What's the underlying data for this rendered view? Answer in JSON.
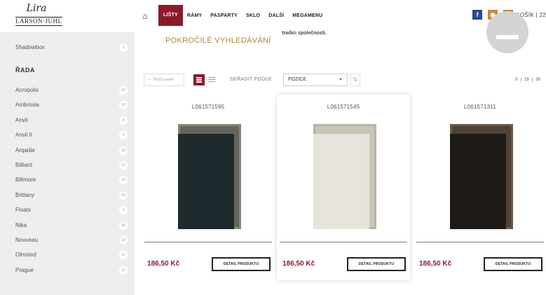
{
  "header": {
    "logo_script": "Lira",
    "logo_text": "LARSON·JUHL",
    "nav_home_icon": "home-icon",
    "nav": [
      "LIŠTY",
      "RÁMY",
      "PASPARTY",
      "SKLO",
      "DALŠÍ",
      "MEGAMENU"
    ],
    "active_nav": "LIŠTY",
    "cart_label": "KOŠÍK | 22"
  },
  "sidebar": {
    "top_item": {
      "label": "Shadowbox",
      "count": "1"
    },
    "section_title": "ŘADA",
    "items": [
      {
        "label": "Acropolis",
        "count": "10"
      },
      {
        "label": "Ambrosia",
        "count": "16"
      },
      {
        "label": "Anvil",
        "count": "4"
      },
      {
        "label": "Anvil II",
        "count": "5"
      },
      {
        "label": "Arqadia",
        "count": "18"
      },
      {
        "label": "Billiard",
        "count": "12"
      },
      {
        "label": "Biltmore",
        "count": "14"
      },
      {
        "label": "Brittany",
        "count": "16"
      },
      {
        "label": "Floats",
        "count": "4"
      },
      {
        "label": "Nika",
        "count": "24"
      },
      {
        "label": "Nouveau",
        "count": "18"
      },
      {
        "label": "Olmsted",
        "count": "11"
      },
      {
        "label": "Prague",
        "count": "12"
      }
    ]
  },
  "main": {
    "advanced_search": "POKROČILÉ VYHLEDÁVÁNÍ",
    "intro_snippet": "tradici společnosti.",
    "hide_panel": "— Skrýt panel",
    "sort_label": "SEŘADIT PODLE",
    "sort_value": "POZICE",
    "per_page": [
      "9",
      "15",
      "30"
    ]
  },
  "products": [
    {
      "code": "L061571595",
      "price": "186,50 Kč",
      "detail": "DETAIL PRODUKTU",
      "frame_color": "#1f2a2e",
      "edge_color": "#8a8578"
    },
    {
      "code": "L061571545",
      "price": "186,50 Kč",
      "detail": "DETAIL PRODUKTU",
      "frame_color": "#e6e4dc",
      "edge_color": "#b8b4a6"
    },
    {
      "code": "L061571311",
      "price": "186,50 Kč",
      "detail": "DETAIL PRODUKTU",
      "frame_color": "#1e1a17",
      "edge_color": "#6a5a4c"
    }
  ],
  "colors": {
    "accent": "#8b1b2c",
    "gold": "#a88a3a",
    "sidebar_bg": "#eeeeee"
  }
}
